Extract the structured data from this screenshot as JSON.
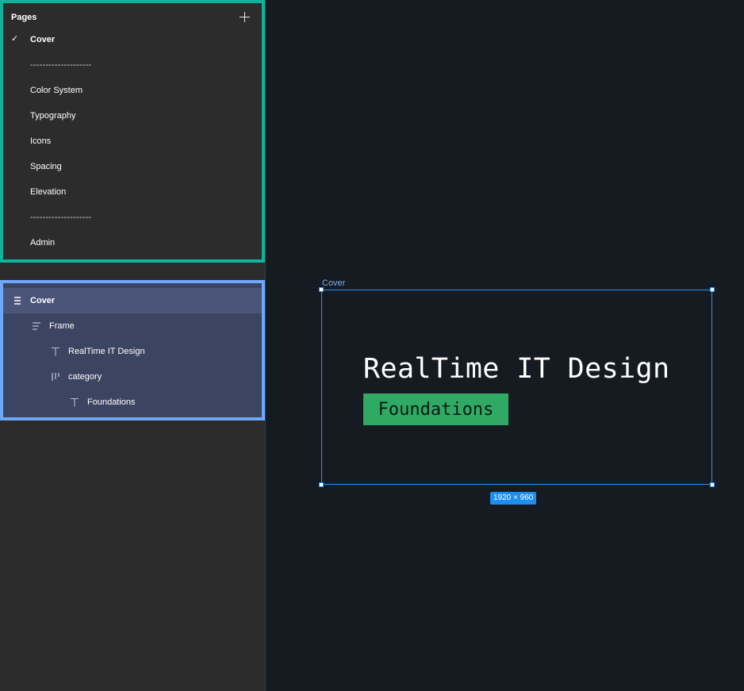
{
  "pages": {
    "title": "Pages",
    "items": [
      {
        "label": "Cover",
        "current": true
      },
      {
        "label": "--------------------",
        "divider": true
      },
      {
        "label": "Color System"
      },
      {
        "label": "Typography"
      },
      {
        "label": "Icons"
      },
      {
        "label": "Spacing"
      },
      {
        "label": "Elevation"
      },
      {
        "label": "--------------------",
        "divider": true
      },
      {
        "label": "Admin"
      }
    ]
  },
  "layers": {
    "items": [
      {
        "label": "Cover",
        "icon": "frame-icon"
      },
      {
        "label": "Frame",
        "icon": "auto-layout-vertical-icon"
      },
      {
        "label": "RealTime IT Design",
        "icon": "text-icon"
      },
      {
        "label": "category",
        "icon": "auto-layout-horizontal-icon"
      },
      {
        "label": "Foundations",
        "icon": "text-icon"
      }
    ]
  },
  "canvas": {
    "frame_name": "Cover",
    "title": "RealTime IT Design",
    "category": "Foundations",
    "size_label": "1920 × 960"
  },
  "colors": {
    "pages_highlight": "#0fb39a",
    "layers_highlight": "#6ea8fe",
    "selection": "#2f8ff0",
    "category_bg": "#2faa64",
    "canvas_bg": "#161a21"
  }
}
